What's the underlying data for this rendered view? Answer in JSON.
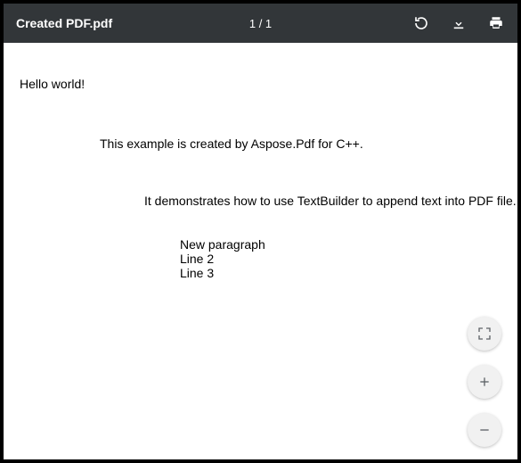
{
  "toolbar": {
    "filename": "Created PDF.pdf",
    "page_indicator": "1 / 1"
  },
  "document": {
    "line1": "Hello world!",
    "line2": "This example is created by Aspose.Pdf for C++.",
    "line3": "It demonstrates how to use TextBuilder to append text into PDF file.",
    "line4": "New paragraph",
    "line5": "Line 2",
    "line6": "Line 3"
  },
  "icons": {
    "rotate": "rotate-icon",
    "download": "download-icon",
    "print": "print-icon",
    "fit": "fit-to-page-icon",
    "zoom_in": "zoom-in-icon",
    "zoom_out": "zoom-out-icon"
  }
}
